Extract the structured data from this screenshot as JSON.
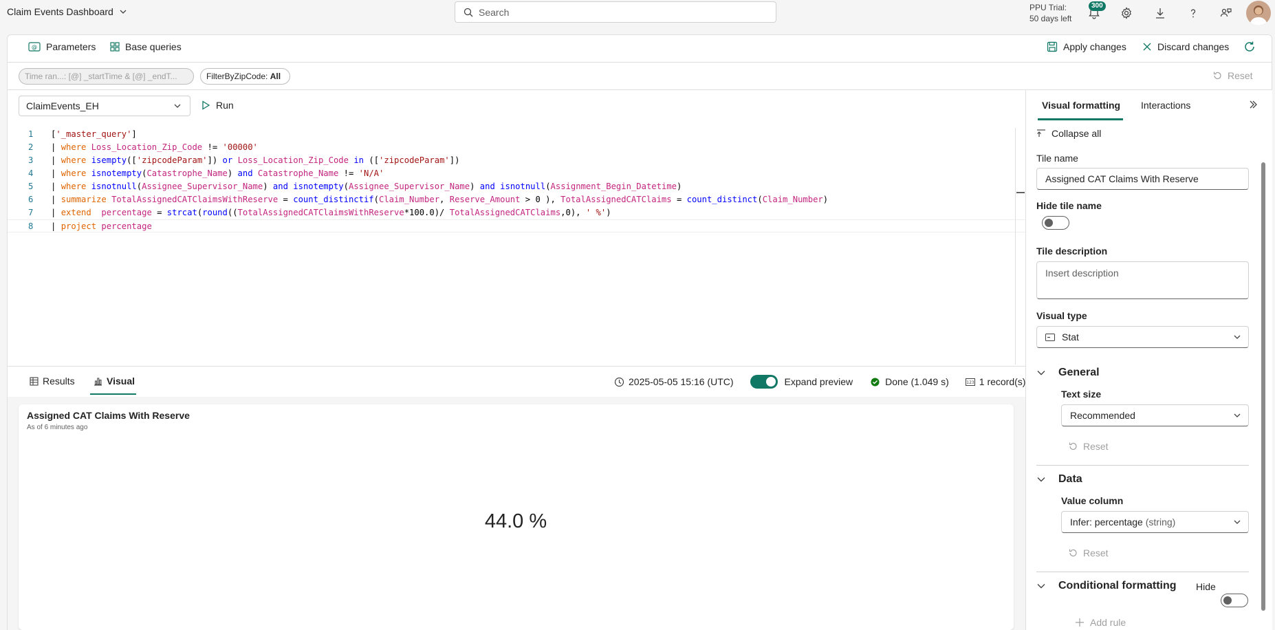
{
  "app": {
    "title": "Claim Events Dashboard"
  },
  "search": {
    "placeholder": "Search"
  },
  "trial": {
    "line1": "PPU Trial:",
    "line2": "50 days left"
  },
  "notifications": {
    "count": "300"
  },
  "toolbar": {
    "parameters_label": "Parameters",
    "base_queries_label": "Base queries",
    "apply_label": "Apply changes",
    "discard_label": "Discard changes"
  },
  "filters": {
    "time_range": "Time ran...: [@] _startTime & [@] _endT...",
    "zip_label": "FilterByZipCode:",
    "zip_value": "All",
    "reset_label": "Reset"
  },
  "editor": {
    "database": "ClaimEvents_EH",
    "run_label": "Run",
    "line_numbers": [
      "1",
      "2",
      "3",
      "4",
      "5",
      "6",
      "7",
      "8"
    ]
  },
  "results": {
    "tab_results": "Results",
    "tab_visual": "Visual",
    "timestamp": "2025-05-05 15:16 (UTC)",
    "expand_preview": "Expand preview",
    "status": "Done (1.049 s)",
    "records": "1 record(s)"
  },
  "tile": {
    "title": "Assigned CAT Claims With Reserve",
    "subtitle": "As of 6 minutes ago",
    "value": "44.0 %"
  },
  "panel": {
    "tab_formatting": "Visual formatting",
    "tab_interactions": "Interactions",
    "collapse_all": "Collapse all",
    "tile_name_label": "Tile name",
    "tile_name_value": "Assigned CAT Claims With Reserve",
    "hide_tile_name_label": "Hide tile name",
    "tile_description_label": "Tile description",
    "tile_description_placeholder": "Insert description",
    "visual_type_label": "Visual type",
    "visual_type_value": "Stat",
    "general_label": "General",
    "text_size_label": "Text size",
    "text_size_value": "Recommended",
    "reset_label": "Reset",
    "data_label": "Data",
    "value_column_label": "Value column",
    "value_column_value": "Infer: percentage",
    "value_column_type": "(string)",
    "conditional_label": "Conditional formatting",
    "hide_label": "Hide",
    "add_rule_label": "Add rule"
  },
  "colors": {
    "accent": "#117865"
  }
}
